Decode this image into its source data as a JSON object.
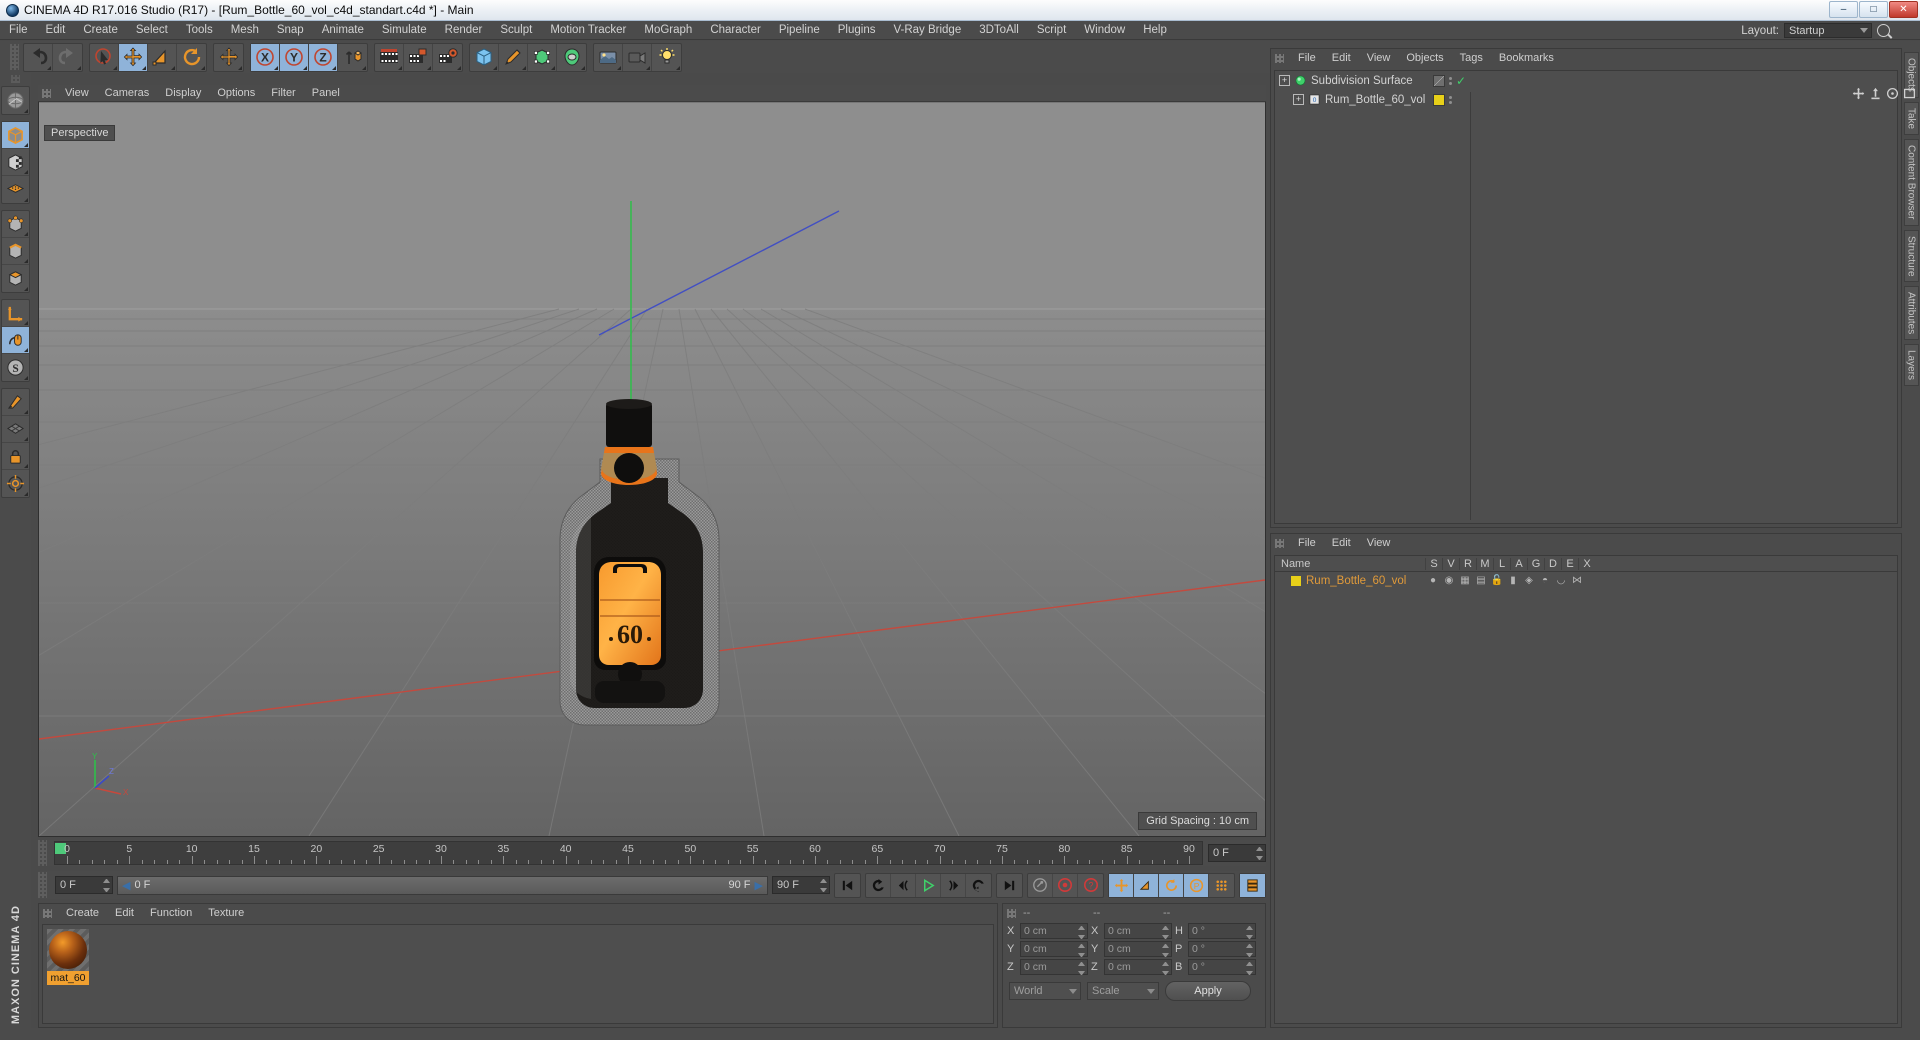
{
  "window": {
    "title": "CINEMA 4D R17.016 Studio (R17) - [Rum_Bottle_60_vol_c4d_standart.c4d *] - Main",
    "minimize": "–",
    "maximize": "□",
    "close": "✕"
  },
  "menubar": {
    "items": [
      "File",
      "Edit",
      "Create",
      "Select",
      "Tools",
      "Mesh",
      "Snap",
      "Animate",
      "Simulate",
      "Render",
      "Sculpt",
      "Motion Tracker",
      "MoGraph",
      "Character",
      "Pipeline",
      "Plugins",
      "V-Ray Bridge",
      "3DToAll",
      "Script",
      "Window",
      "Help"
    ],
    "layout_label": "Layout:",
    "layout_value": "Startup"
  },
  "toolbar": {
    "groups": [
      {
        "name": "undo-redo",
        "buttons": [
          {
            "icon": "undo-icon",
            "selected": false
          },
          {
            "icon": "redo-icon",
            "selected": false
          }
        ]
      },
      {
        "name": "select-transform",
        "buttons": [
          {
            "icon": "live-selection-icon",
            "selected": false
          },
          {
            "icon": "move-icon",
            "selected": true
          },
          {
            "icon": "scale-icon",
            "selected": false
          },
          {
            "icon": "rotate-icon",
            "selected": false
          }
        ]
      },
      {
        "name": "move-active",
        "buttons": [
          {
            "icon": "move-tool-icon",
            "selected": false
          }
        ]
      },
      {
        "name": "axis-locks",
        "buttons": [
          {
            "icon": "x-axis-icon",
            "selected": true
          },
          {
            "icon": "y-axis-icon",
            "selected": true
          },
          {
            "icon": "z-axis-icon",
            "selected": true
          },
          {
            "icon": "world-object-axis-icon",
            "selected": false
          }
        ]
      },
      {
        "name": "render-group",
        "buttons": [
          {
            "icon": "render-view-icon",
            "selected": false
          },
          {
            "icon": "render-region-icon",
            "selected": false
          },
          {
            "icon": "render-settings-icon",
            "selected": false
          }
        ]
      },
      {
        "name": "primitives",
        "buttons": [
          {
            "icon": "cube-primitive-icon",
            "selected": false
          },
          {
            "icon": "spline-pen-icon",
            "selected": false
          },
          {
            "icon": "generator-icon",
            "selected": false
          },
          {
            "icon": "deformer-icon",
            "selected": false
          }
        ]
      },
      {
        "name": "scene-objects",
        "buttons": [
          {
            "icon": "environment-icon",
            "selected": false
          },
          {
            "icon": "camera-icon",
            "selected": false
          },
          {
            "icon": "light-icon",
            "selected": false
          }
        ]
      }
    ]
  },
  "left_toolbar": {
    "groups": [
      {
        "buttons": [
          {
            "icon": "world-axis-icon",
            "selected": false
          }
        ]
      },
      {
        "buttons": [
          {
            "icon": "make-editable-icon",
            "selected": true
          },
          {
            "icon": "texture-axis-icon",
            "selected": false
          },
          {
            "icon": "viewport-solo-icon",
            "selected": false
          }
        ]
      },
      {
        "buttons": [
          {
            "icon": "point-mode-icon",
            "selected": false
          },
          {
            "icon": "edge-mode-icon",
            "selected": false
          },
          {
            "icon": "polygon-mode-icon",
            "selected": false
          }
        ]
      },
      {
        "buttons": [
          {
            "icon": "axis-modify-icon",
            "selected": false
          },
          {
            "icon": "enable-snapping-icon",
            "selected": true
          },
          {
            "icon": "workplane-icon",
            "selected": false
          }
        ]
      },
      {
        "buttons": [
          {
            "icon": "knife-icon",
            "selected": false
          },
          {
            "icon": "grid-surface-icon",
            "selected": false
          },
          {
            "icon": "lock-icon",
            "selected": false
          },
          {
            "icon": "modelling-axis-icon",
            "selected": false
          }
        ]
      }
    ],
    "brand": "MAXON CINEMA 4D"
  },
  "viewport": {
    "menu": [
      "View",
      "Cameras",
      "Display",
      "Options",
      "Filter",
      "Panel"
    ],
    "camera_label": "Perspective",
    "grid_spacing": "Grid Spacing : 10 cm",
    "axis_labels": {
      "x": "X",
      "y": "Y",
      "z": "Z"
    },
    "model": {
      "label_text": "60",
      "name": "Rum_Bottle_60_vol"
    }
  },
  "timeline": {
    "ticks": [
      {
        "value": "0",
        "pos": 0
      },
      {
        "value": "5",
        "pos": 5
      },
      {
        "value": "10",
        "pos": 10
      },
      {
        "value": "15",
        "pos": 15
      },
      {
        "value": "20",
        "pos": 20
      },
      {
        "value": "25",
        "pos": 25
      },
      {
        "value": "30",
        "pos": 30
      },
      {
        "value": "35",
        "pos": 35
      },
      {
        "value": "40",
        "pos": 40
      },
      {
        "value": "45",
        "pos": 45
      },
      {
        "value": "50",
        "pos": 50
      },
      {
        "value": "55",
        "pos": 55
      },
      {
        "value": "60",
        "pos": 60
      },
      {
        "value": "65",
        "pos": 65
      },
      {
        "value": "70",
        "pos": 70
      },
      {
        "value": "75",
        "pos": 75
      },
      {
        "value": "80",
        "pos": 80
      },
      {
        "value": "85",
        "pos": 85
      },
      {
        "value": "90",
        "pos": 90
      }
    ],
    "range_start": 0,
    "range_end": 90,
    "current_frame_field": "0 F",
    "current_frame_right": "0 F",
    "range_left": "0 F",
    "range_right": "90 F",
    "end_frame_field": "90 F",
    "playback": [
      {
        "icon": "go-to-start-icon",
        "selected": false
      },
      {
        "icon": "play-backwards-icon",
        "selected": false
      },
      {
        "icon": "step-back-icon",
        "selected": false
      },
      {
        "icon": "play-forward-icon",
        "selected": false
      },
      {
        "icon": "step-forward-icon",
        "selected": false
      },
      {
        "icon": "loop-icon",
        "selected": false
      },
      {
        "icon": "go-to-end-icon",
        "selected": false
      }
    ],
    "record_tools": [
      {
        "icon": "autokey-icon",
        "selected": false
      },
      {
        "icon": "record-active-objects-icon",
        "selected": false
      },
      {
        "icon": "keyframe-selection-icon",
        "selected": false
      }
    ],
    "key_toggles": [
      {
        "icon": "key-position-icon",
        "selected": true
      },
      {
        "icon": "key-scale-icon",
        "selected": true
      },
      {
        "icon": "key-rotation-icon",
        "selected": true
      },
      {
        "icon": "key-parameter-icon",
        "selected": true
      },
      {
        "icon": "key-point-level-icon",
        "selected": false
      },
      {
        "icon": "timeline-window-icon",
        "selected": true
      }
    ]
  },
  "material_manager": {
    "menu": [
      "Create",
      "Edit",
      "Function",
      "Texture"
    ],
    "materials": [
      {
        "name": "mat_60",
        "selected": true
      }
    ]
  },
  "coordinates_manager": {
    "headers": [
      "--",
      "--",
      "--"
    ],
    "rows": [
      {
        "label1": "X",
        "value1": "0 cm",
        "label2": "X",
        "value2": "0 cm",
        "label3": "H",
        "value3": "0 °"
      },
      {
        "label1": "Y",
        "value1": "0 cm",
        "label2": "Y",
        "value2": "0 cm",
        "label3": "P",
        "value3": "0 °"
      },
      {
        "label1": "Z",
        "value1": "0 cm",
        "label2": "Z",
        "value2": "0 cm",
        "label3": "B",
        "value3": "0 °"
      }
    ],
    "coord_system": "World",
    "transform_mode": "Scale",
    "apply_label": "Apply"
  },
  "object_manager": {
    "menu": [
      "File",
      "Edit",
      "View",
      "Objects",
      "Tags",
      "Bookmarks"
    ],
    "objects": [
      {
        "name": "Subdivision Surface",
        "depth": 0,
        "icon": "subdivision-surface-icon",
        "tag_color": "none",
        "check": true
      },
      {
        "name": "Rum_Bottle_60_vol",
        "depth": 1,
        "icon": "polygon-object-icon",
        "tag_color": "#e8d019",
        "check": false
      }
    ]
  },
  "layer_manager": {
    "menu": [
      "File",
      "Edit",
      "View"
    ],
    "columns": [
      "Name",
      "S",
      "V",
      "R",
      "M",
      "L",
      "A",
      "G",
      "D",
      "E",
      "X"
    ],
    "rows": [
      {
        "name": "Rum_Bottle_60_vol",
        "color": "#e8d019"
      }
    ]
  },
  "right_dock": {
    "tabs": [
      "Objects",
      "Take",
      "Content Browser",
      "Structure",
      "Attributes",
      "Layers"
    ]
  },
  "colors": {
    "accent_orange": "#e8952a",
    "selection_blue": "#8fb3d9",
    "panel_bg": "#4b4b4b",
    "green_axis": "#2fbf4a",
    "red_axis": "#d4392f",
    "blue_axis": "#3a49c8"
  }
}
